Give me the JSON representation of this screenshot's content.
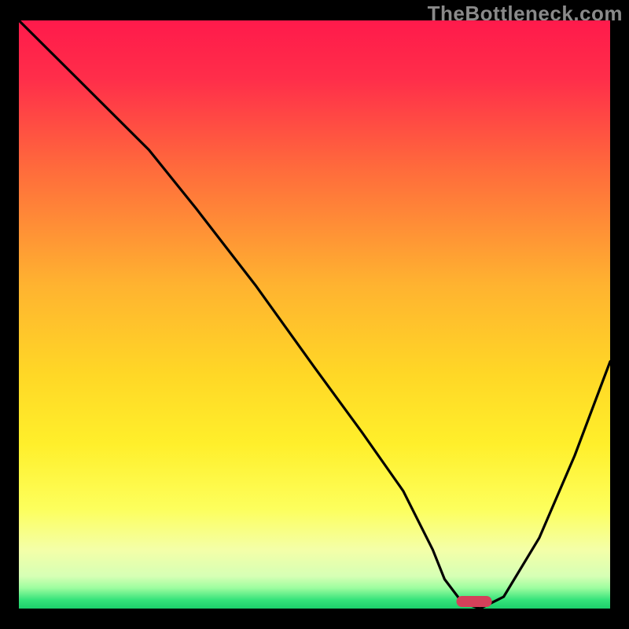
{
  "watermark": "TheBottleneck.com",
  "colors": {
    "gradient_stops": [
      {
        "offset": 0.0,
        "color": "#ff1a4b"
      },
      {
        "offset": 0.1,
        "color": "#ff2e4a"
      },
      {
        "offset": 0.25,
        "color": "#ff6a3c"
      },
      {
        "offset": 0.45,
        "color": "#ffb330"
      },
      {
        "offset": 0.6,
        "color": "#ffd726"
      },
      {
        "offset": 0.72,
        "color": "#ffef2b"
      },
      {
        "offset": 0.83,
        "color": "#fdff5c"
      },
      {
        "offset": 0.9,
        "color": "#f4ffa8"
      },
      {
        "offset": 0.945,
        "color": "#d6ffb5"
      },
      {
        "offset": 0.965,
        "color": "#9dfd9f"
      },
      {
        "offset": 0.985,
        "color": "#36e37b"
      },
      {
        "offset": 1.0,
        "color": "#1ccf6b"
      }
    ],
    "curve": "#000000",
    "marker": "#d4405a"
  },
  "chart_data": {
    "type": "line",
    "title": "",
    "xlabel": "",
    "ylabel": "",
    "xlim": [
      0,
      100
    ],
    "ylim": [
      0,
      100
    ],
    "x": [
      0,
      10,
      22,
      30,
      40,
      50,
      58,
      65,
      70,
      72,
      75,
      78,
      82,
      88,
      94,
      100
    ],
    "values": [
      100,
      90,
      78,
      68,
      55,
      41,
      30,
      20,
      10,
      5,
      1,
      0,
      2,
      12,
      26,
      42
    ],
    "optimum_x": 77,
    "optimum_width": 6
  }
}
